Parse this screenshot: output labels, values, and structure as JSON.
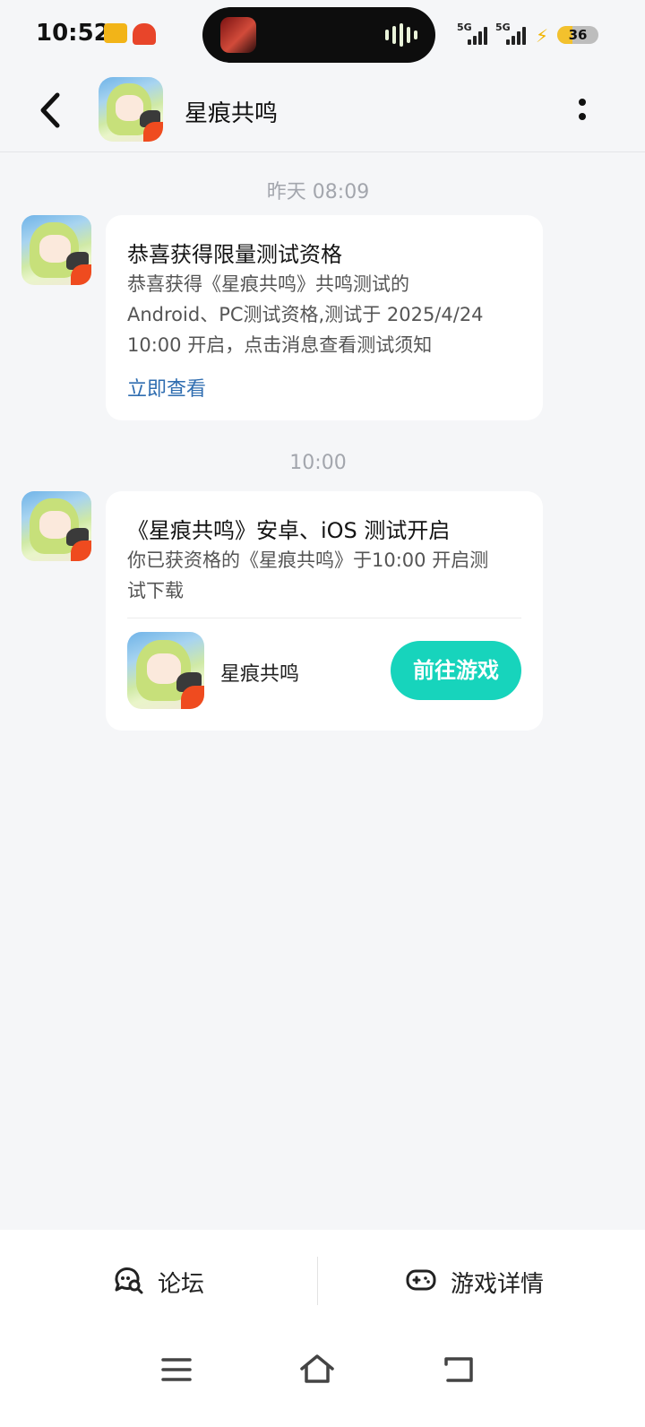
{
  "status_bar": {
    "time": "10:52",
    "network_1": "5G",
    "network_2": "5G",
    "battery_level": "36",
    "battery_fraction": 0.36,
    "island_icon": "now-playing-thumbnail",
    "island_wave_icon": "audio-wave-icon"
  },
  "header": {
    "title": "星痕共鸣",
    "back_icon": "chevron-left-icon",
    "more_icon": "vertical-dots-icon"
  },
  "messages": [
    {
      "timestamp": "昨天  08:09",
      "title": "恭喜获得限量测试资格",
      "body_lines": [
        "恭喜获得《星痕共鸣》共鸣测试的",
        "Android、PC测试资格,测试于 2025/4/24",
        "10:00 开启，点击消息查看测试须知"
      ],
      "link": "立即查看"
    },
    {
      "timestamp": "10:00",
      "title": "《星痕共鸣》安卓、iOS 测试开启",
      "body_lines": [
        "你已获资格的《星痕共鸣》于10:00 开启测",
        "试下载"
      ],
      "game_name": "星痕共鸣",
      "button": "前往游戏"
    }
  ],
  "bottom_tabs": [
    {
      "label": "论坛",
      "icon": "forum-chat-icon"
    },
    {
      "label": "游戏详情",
      "icon": "gamepad-icon"
    }
  ],
  "nav_bar": {
    "menu_icon": "menu-icon",
    "home_icon": "home-icon",
    "back_icon": "back-icon"
  },
  "colors": {
    "accent": "#17d4bc",
    "link": "#2f6db0",
    "background": "#f5f6f8"
  }
}
